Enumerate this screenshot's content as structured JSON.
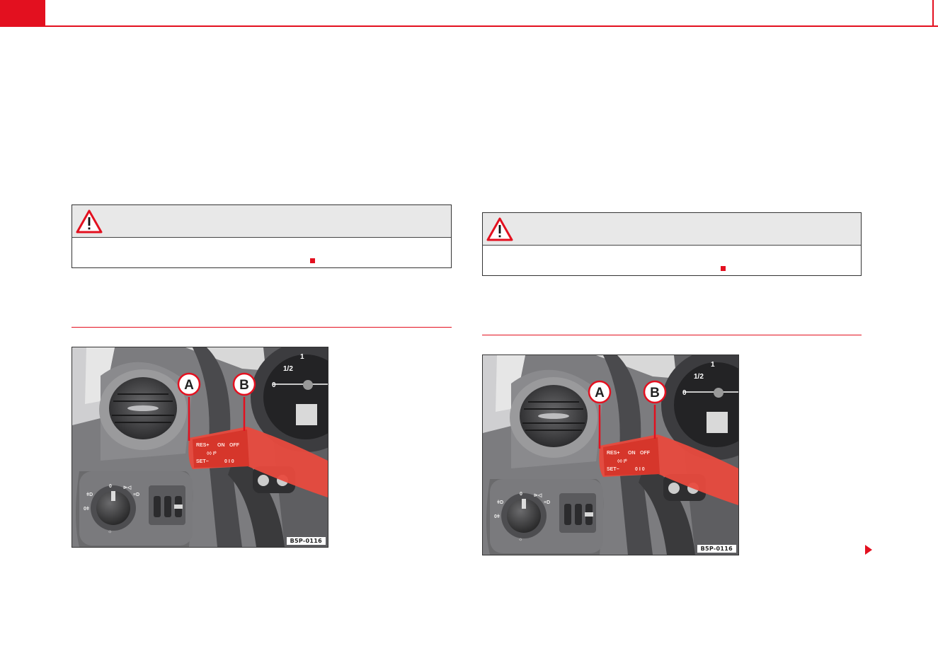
{
  "colors": {
    "accent": "#e3101f",
    "callout_bg": "#e8e8e8"
  },
  "left_column": {
    "warning": {
      "icon": "warning-triangle-icon",
      "end_marker": "red-square"
    },
    "figure": {
      "code": "B5P-0116",
      "callout_a": "A",
      "callout_b": "B"
    }
  },
  "right_column": {
    "warning": {
      "icon": "warning-triangle-icon",
      "end_marker": "red-square"
    },
    "figure": {
      "code": "B5P-0116",
      "callout_a": "A",
      "callout_b": "B"
    },
    "continue_icon": "next-page-arrow-icon"
  }
}
